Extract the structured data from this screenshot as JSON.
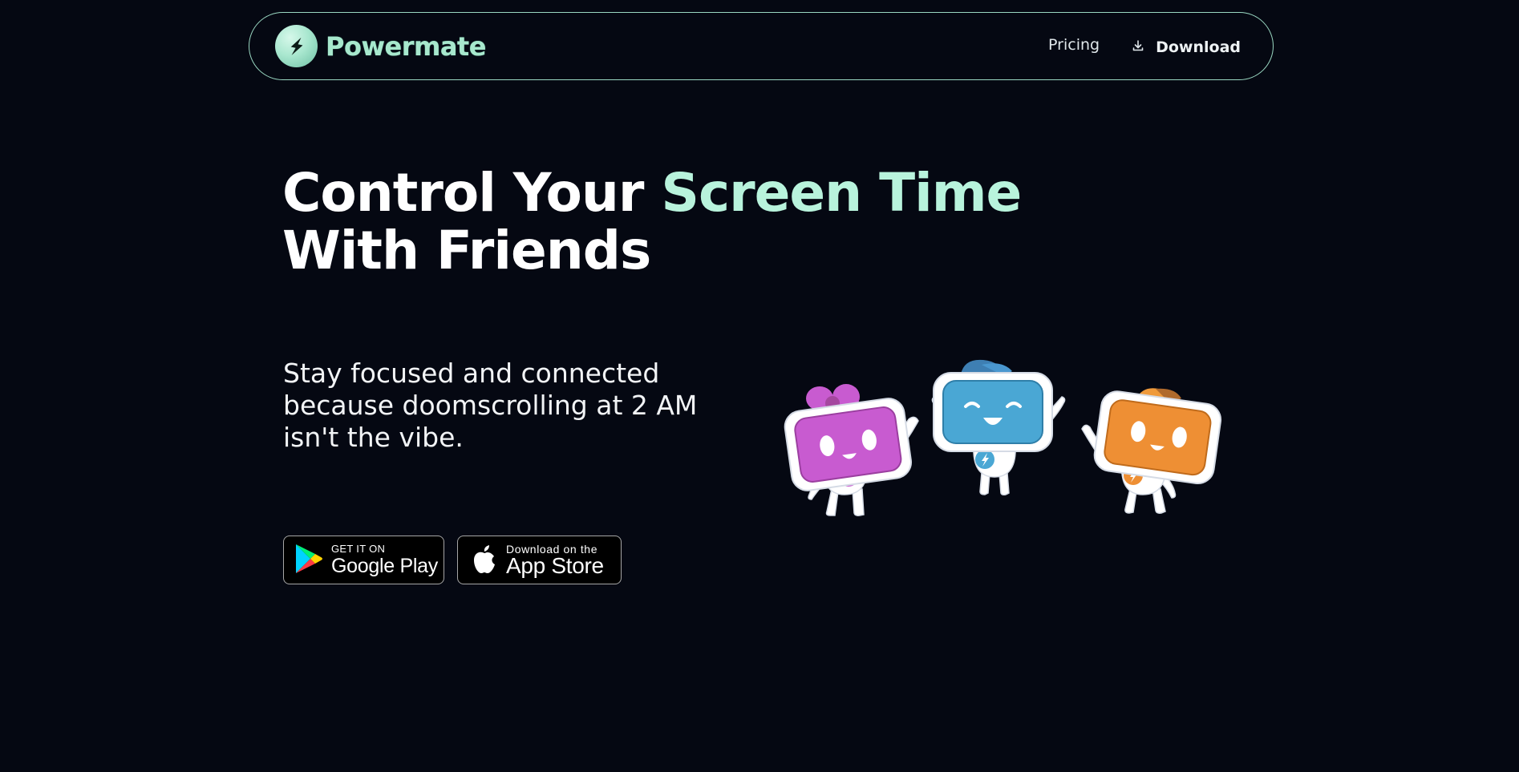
{
  "nav": {
    "brand_name": "Powermate",
    "links": [
      {
        "label": "Pricing"
      },
      {
        "label": "Download"
      }
    ]
  },
  "hero": {
    "title_part1": "Control Your ",
    "title_accent": "Screen Time",
    "title_part2": "With Friends",
    "subtitle": "Stay focused and connected because doomscrolling at 2 AM isn't the vibe."
  },
  "badges": {
    "google": {
      "small": "GET IT ON",
      "big": "Google Play"
    },
    "apple": {
      "small": "Download on the",
      "big": "App Store"
    }
  },
  "colors": {
    "background": "#050812",
    "accent": "#b8f3dc",
    "nav_border": "#9ad8c2",
    "robot_pink": "#c85bd0",
    "robot_blue": "#4aa7d4",
    "robot_orange": "#ee8f34"
  },
  "illustration": {
    "description_icon": "three-robot-mascots-icon"
  }
}
